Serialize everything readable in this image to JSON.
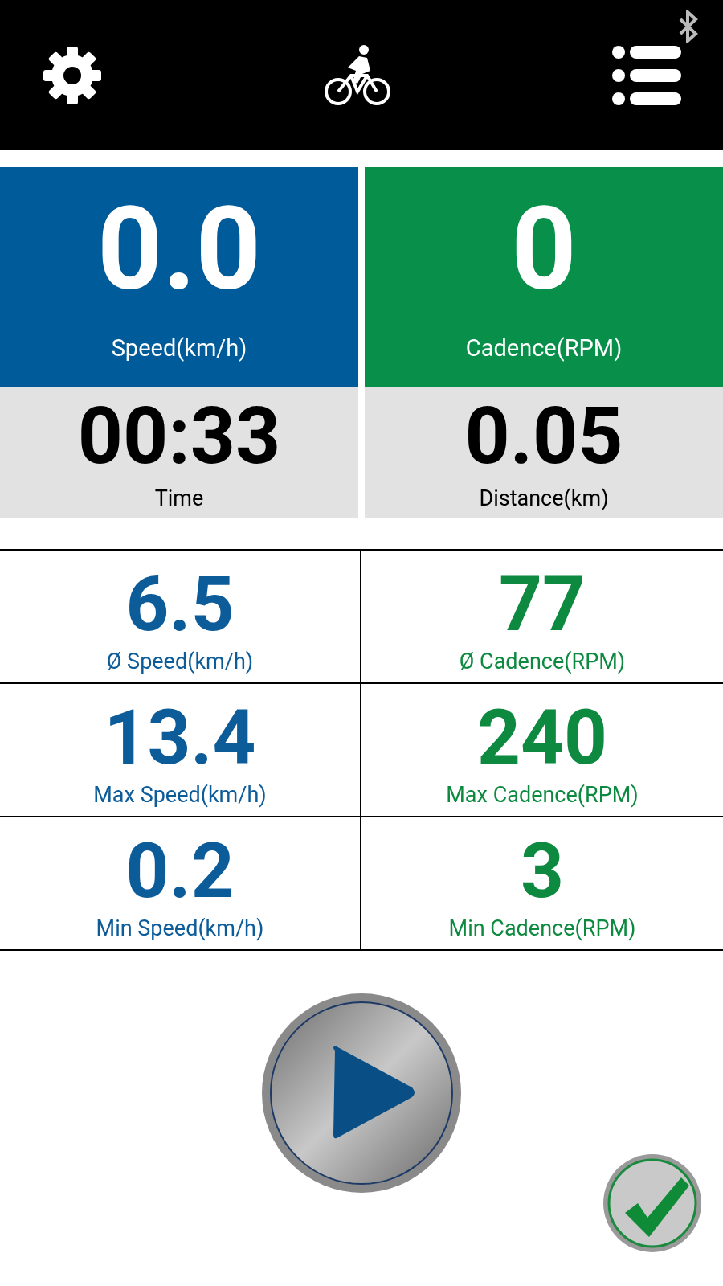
{
  "tiles": [
    {
      "value": "0.0",
      "label": "Speed(km/h)",
      "kind": "primary",
      "color": "#005b9b"
    },
    {
      "value": "0",
      "label": "Cadence(RPM)",
      "kind": "primary",
      "color": "#08904a"
    },
    {
      "value": "00:33",
      "label": "Time",
      "kind": "secondary"
    },
    {
      "value": "0.05",
      "label": "Distance(km)",
      "kind": "secondary"
    }
  ],
  "stats": [
    {
      "value": "6.5",
      "label": "Ø Speed(km/h)",
      "color": "#0d5c9a"
    },
    {
      "value": "77",
      "label": "Ø Cadence(RPM)",
      "color": "#0d8a40"
    },
    {
      "value": "13.4",
      "label": "Max Speed(km/h)",
      "color": "#0d5c9a"
    },
    {
      "value": "240",
      "label": "Max Cadence(RPM)",
      "color": "#0d8a40"
    },
    {
      "value": "0.2",
      "label": "Min Speed(km/h)",
      "color": "#0d5c9a"
    },
    {
      "value": "3",
      "label": "Min Cadence(RPM)",
      "color": "#0d8a40"
    }
  ]
}
